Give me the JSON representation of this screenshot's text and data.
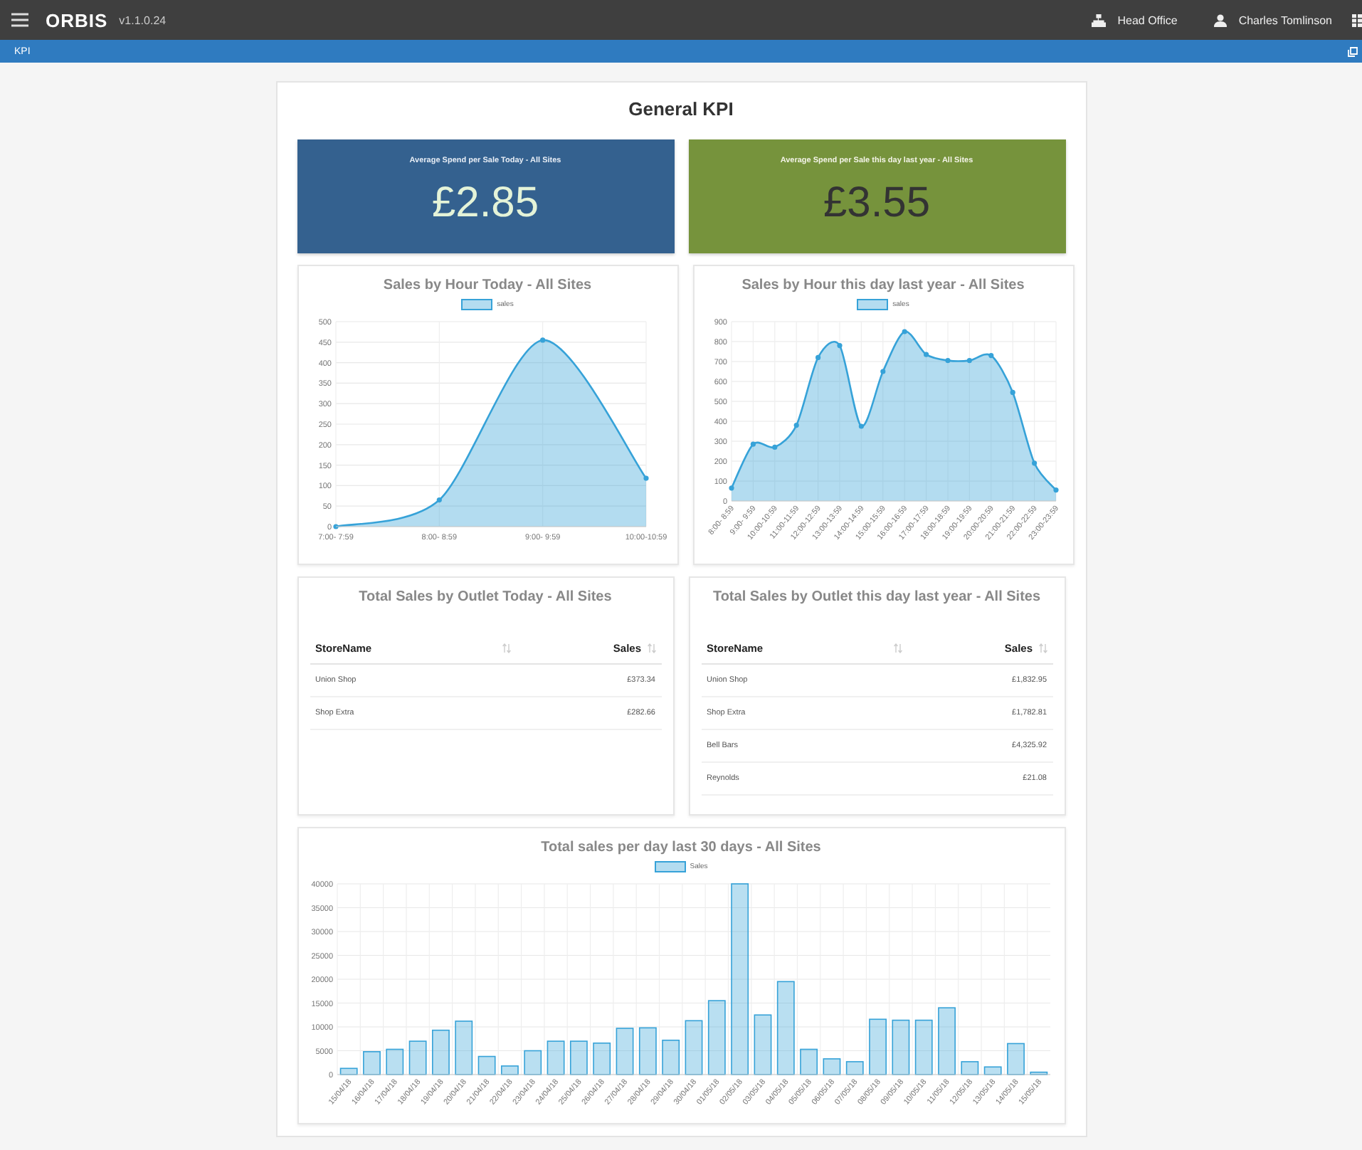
{
  "header": {
    "logo": "ORBIS",
    "version": "v1.1.0.24",
    "location": "Head Office",
    "user": "Charles Tomlinson"
  },
  "tab_bar": {
    "title": "KPI"
  },
  "page": {
    "title": "General KPI"
  },
  "stats": [
    {
      "label": "Average Spend per Sale Today - All Sites",
      "value": "£2.85",
      "color": "#34618f"
    },
    {
      "label": "Average Spend per Sale this day last year - All Sites",
      "value": "£3.55",
      "color": "#76933c"
    }
  ],
  "hour_charts": [
    {
      "title": "Sales by Hour Today - All Sites",
      "chart_data": {
        "type": "area",
        "categories": [
          "7:00- 7:59",
          "8:00- 8:59",
          "9:00- 9:59",
          "10:00-10:59"
        ],
        "series": [
          {
            "name": "sales",
            "type": "area",
            "color": "#36a2d8",
            "values": [
              0,
              65,
              455,
              118
            ]
          }
        ],
        "grid": true,
        "ylim": [
          0,
          500
        ],
        "yticks": [
          0,
          50,
          100,
          150,
          200,
          250,
          300,
          350,
          400,
          450,
          500
        ]
      }
    },
    {
      "title": "Sales by Hour this day last year - All Sites",
      "chart_data": {
        "type": "area",
        "categories": [
          "8:00- 8:59",
          "9:00- 9:59",
          "10:00-10:59",
          "11:00-11:59",
          "12:00-12:59",
          "13:00-13:59",
          "14:00-14:59",
          "15:00-15:59",
          "16:00-16:59",
          "17:00-17:59",
          "18:00-18:59",
          "19:00-19:59",
          "20:00-20:59",
          "21:00-21:59",
          "22:00-22:59",
          "23:00-23:59"
        ],
        "series": [
          {
            "name": "sales",
            "color": "#36a2d8",
            "values": [
              65,
              285,
              270,
              380,
              720,
              780,
              375,
              650,
              850,
              735,
              705,
              705,
              730,
              545,
              190,
              55
            ]
          }
        ],
        "grid": true,
        "ylim": [
          0,
          900
        ],
        "yticks": [
          0,
          100,
          200,
          300,
          400,
          500,
          600,
          700,
          800,
          900
        ]
      }
    }
  ],
  "outlet_tables": [
    {
      "title": "Total Sales by Outlet Today - All Sites",
      "columns": [
        "StoreName",
        "Sales"
      ],
      "rows": [
        {
          "store": "Union Shop",
          "sales": "£373.34"
        },
        {
          "store": "Shop Extra",
          "sales": "£282.66"
        }
      ]
    },
    {
      "title": "Total Sales by Outlet this day last year - All Sites",
      "columns": [
        "StoreName",
        "Sales"
      ],
      "rows": [
        {
          "store": "Union Shop",
          "sales": "£1,832.95"
        },
        {
          "store": "Shop Extra",
          "sales": "£1,782.81"
        },
        {
          "store": "Bell Bars",
          "sales": "£4,325.92"
        },
        {
          "store": "Reynolds",
          "sales": "£21.08"
        }
      ]
    }
  ],
  "daily_chart": {
    "title": "Total sales per day last 30 days - All Sites",
    "chart_data": {
      "type": "bar",
      "categories": [
        "15/04/18",
        "16/04/18",
        "17/04/18",
        "18/04/18",
        "19/04/18",
        "20/04/18",
        "21/04/18",
        "22/04/18",
        "23/04/18",
        "24/04/18",
        "25/04/18",
        "26/04/18",
        "27/04/18",
        "28/04/18",
        "29/04/18",
        "30/04/18",
        "01/05/18",
        "02/05/18",
        "03/05/18",
        "04/05/18",
        "05/05/18",
        "06/05/18",
        "07/05/18",
        "08/05/18",
        "09/05/18",
        "10/05/18",
        "11/05/18",
        "12/05/18",
        "13/05/18",
        "14/05/18",
        "15/05/18"
      ],
      "series": [
        {
          "name": "Sales",
          "color": "#36a2d8",
          "values": [
            1300,
            4800,
            5300,
            7000,
            9300,
            11200,
            3800,
            1800,
            5000,
            7000,
            7000,
            6600,
            9700,
            9800,
            7200,
            11300,
            15500,
            40000,
            12500,
            19500,
            5300,
            3300,
            2700,
            11600,
            11400,
            11400,
            14000,
            2700,
            1600,
            6500,
            500
          ]
        }
      ],
      "grid": true,
      "ylim": [
        0,
        40000
      ],
      "yticks": [
        0,
        5000,
        10000,
        15000,
        20000,
        25000,
        30000,
        35000,
        40000
      ]
    }
  }
}
